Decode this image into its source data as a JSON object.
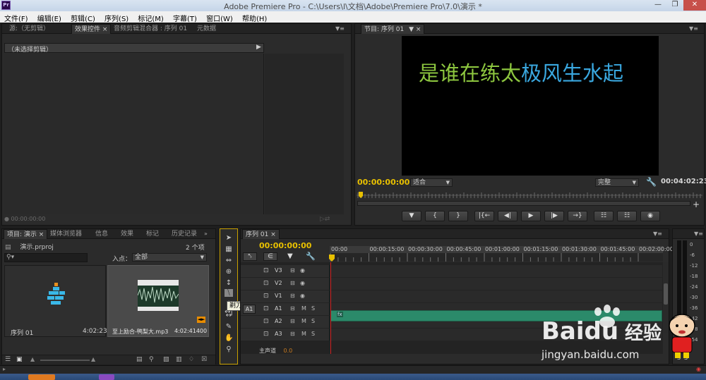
{
  "window": {
    "title": "Adobe Premiere Pro - C:\\Users\\l\\文档\\Adobe\\Premiere Pro\\7.0\\演示 *",
    "app_icon": "Pr"
  },
  "menu": [
    "文件(F)",
    "编辑(E)",
    "剪辑(C)",
    "序列(S)",
    "标记(M)",
    "字幕(T)",
    "窗口(W)",
    "帮助(H)"
  ],
  "source_panel": {
    "tabs": [
      "源:（无剪辑）",
      "效果控件",
      "音频剪辑混合器 : 序列 01",
      "元数据"
    ],
    "clip_header": "（未选择剪辑）",
    "timecode": "00:00:00:00"
  },
  "program_monitor": {
    "tab": "节目: 序列 01",
    "title_text_part1": "是谁在练太",
    "title_text_part2": "极风生水起",
    "title_color1": "#8dc63f",
    "title_color2": "#3aa8e0",
    "timecode_left": "00:00:00:00",
    "zoom": "适合",
    "quality": "完整",
    "timecode_right": "00:04:02:23",
    "transport_buttons": [
      "marker-icon",
      "mark-in-icon",
      "mark-out-icon",
      "go-to-in-icon",
      "step-back-icon",
      "play-icon",
      "step-forward-icon",
      "go-to-out-icon",
      "lift-icon",
      "extract-icon",
      "camera-icon"
    ]
  },
  "project_panel": {
    "tabs": [
      "项目: 演示",
      "媒体浏览器",
      "信息",
      "效果",
      "标记",
      "历史记录"
    ],
    "project_file": "演示.prproj",
    "item_count": "2 个项",
    "search_placeholder": "",
    "in_point_label": "入点：",
    "in_point_value": "全部",
    "items": [
      {
        "name": "序列 01",
        "duration": "4:02:23"
      },
      {
        "name": "至上励合-鸭梨大.mp3",
        "duration": "4:02:41400"
      }
    ]
  },
  "tools": {
    "tooltip": "剃刀工具 (C)",
    "icons": [
      "selection-tool-icon",
      "track-select-tool-icon",
      "ripple-edit-tool-icon",
      "rolling-edit-tool-icon",
      "rate-stretch-tool-icon",
      "razor-tool-icon",
      "slip-tool-icon",
      "slide-tool-icon",
      "pen-tool-icon",
      "hand-tool-icon",
      "zoom-tool-icon"
    ]
  },
  "timeline": {
    "tab": "序列 01",
    "timecode": "00:00:00:00",
    "ruler": [
      "00:00",
      "00:00:15:00",
      "00:00:30:00",
      "00:00:45:00",
      "00:01:00:00",
      "00:01:15:00",
      "00:01:30:00",
      "00:01:45:00",
      "00:02:00:00"
    ],
    "tracks": [
      {
        "name": "V3",
        "type": "video"
      },
      {
        "name": "V2",
        "type": "video"
      },
      {
        "name": "V1",
        "type": "video"
      },
      {
        "name": "A1",
        "type": "audio",
        "source": "A1"
      },
      {
        "name": "A2",
        "type": "audio"
      },
      {
        "name": "A3",
        "type": "audio"
      }
    ],
    "master_label": "主声道",
    "master_value": "0.0",
    "mute_label": "M",
    "solo_label": "S"
  },
  "meters": {
    "labels": [
      "0",
      "-6",
      "-12",
      "-18",
      "-24",
      "-30",
      "-36",
      "-42",
      "-48",
      "-54"
    ],
    "footer": [
      "S",
      "S"
    ]
  },
  "watermark": {
    "brand": "Bai",
    "brand2": "du",
    "site": "经验",
    "url": "jingyan.baidu.com"
  }
}
